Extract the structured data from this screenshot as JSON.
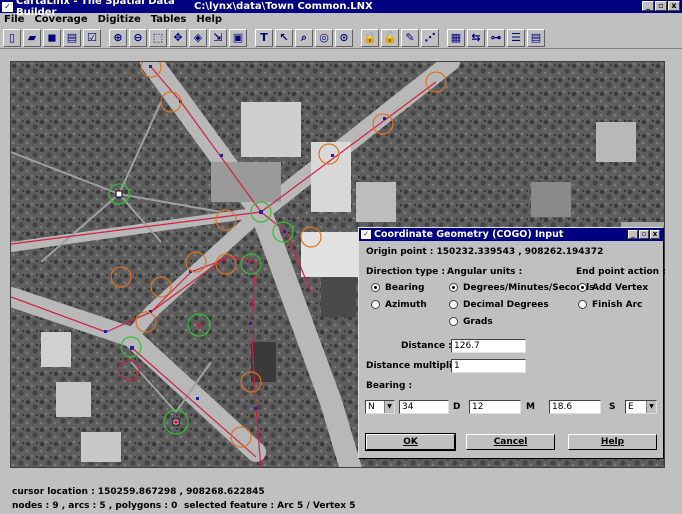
{
  "window": {
    "app_title": "CartaLinx - The Spatial Data Builder",
    "doc_path": "C:\\lynx\\data\\Town Common.LNX",
    "controls": [
      "_",
      "▫",
      "x"
    ]
  },
  "menu": [
    "File",
    "Coverage",
    "Digitize",
    "Tables",
    "Help"
  ],
  "toolbar": {
    "icons": [
      "new-file-icon",
      "open-folder-icon",
      "save-icon",
      "print-icon",
      "check-icon",
      "zoom-in-icon",
      "zoom-out-icon",
      "zoom-extent-icon",
      "pan-icon",
      "layer-icon",
      "export-icon",
      "window-icon",
      "text-tool-icon",
      "select-arrow-icon",
      "query-icon",
      "node-icon",
      "target-icon",
      "lock-icon",
      "unlock-icon",
      "draw-icon",
      "digitize-icon",
      "grid-icon",
      "flip-icon",
      "tree-icon",
      "list-icon",
      "calculator-icon"
    ],
    "glyphs": [
      "▯",
      "▰",
      "◼",
      "▤",
      "☑",
      "⊕",
      "⊖",
      "⬚",
      "✥",
      "◈",
      "⇲",
      "▣",
      "T",
      "↖",
      "⌕",
      "◎",
      "⊙",
      "🔒",
      "🔓",
      "✎",
      "⋰",
      "▦",
      "⇆",
      "⊶",
      "☰",
      "▤"
    ]
  },
  "dialog": {
    "title": "Coordinate Geometry (COGO) Input",
    "origin_label": "Origin point : 150232.339543 , 908262.194372",
    "direction_type_label": "Direction type :",
    "direction_options": [
      "Bearing",
      "Azimuth"
    ],
    "direction_selected": "Bearing",
    "angular_units_label": "Angular units :",
    "angular_options": [
      "Degrees/Minutes/Seconds",
      "Decimal Degrees",
      "Grads"
    ],
    "angular_selected": "Degrees/Minutes/Seconds",
    "end_point_label": "End point action :",
    "end_point_options": [
      "Add Vertex",
      "Finish Arc"
    ],
    "end_point_selected": "Add Vertex",
    "distance_label": "Distance :",
    "distance_value": "126.7",
    "multiplier_label": "Distance multiplier :",
    "multiplier_value": "1",
    "bearing_label": "Bearing :",
    "bearing_ns": "N",
    "bearing_degrees": "34",
    "bearing_d_label": "D",
    "bearing_minutes": "12",
    "bearing_m_label": "M",
    "bearing_seconds": "18.6",
    "bearing_s_label": "S",
    "bearing_ew": "E",
    "ok_label": "OK",
    "cancel_label": "Cancel",
    "help_label": "Help"
  },
  "status": {
    "cursor_location": "cursor location : 150259.867298 , 908268.622845",
    "counts": "nodes : 9 ,   arcs : 5 ,   polygons : 0",
    "selected": "selected feature : Arc 5 / Vertex 5"
  },
  "colors": {
    "titlebar": "#000080",
    "arc_line": "#d02040",
    "snap_circle_orange": "#e07020",
    "snap_circle_green": "#30c030",
    "vertex": "#2020a0"
  }
}
